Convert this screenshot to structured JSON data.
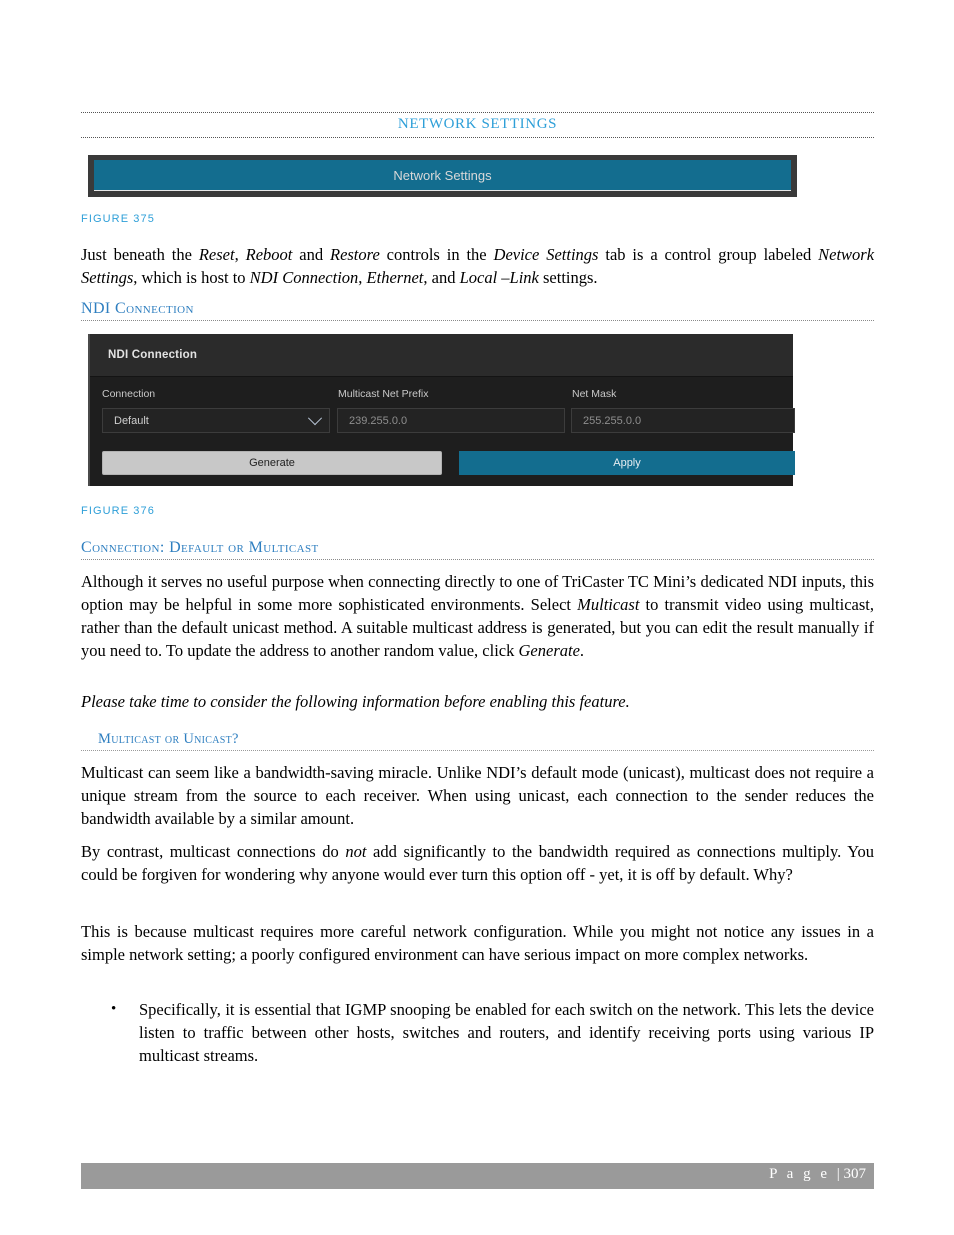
{
  "document": {
    "running_header": "Network Settings",
    "page_footer_prefix": "P a g e ",
    "page_footer_sep": "| ",
    "page_number": "307"
  },
  "figure_375": {
    "caption": "FIGURE 375",
    "bar_label": "Network Settings",
    "bar_color": "#136d8f",
    "frame_color": "#3a3a3a"
  },
  "intro_paragraph": {
    "segments": [
      {
        "text": "Just beneath the ",
        "style": "normal"
      },
      {
        "text": "Reset",
        "style": "italic"
      },
      {
        "text": ", ",
        "style": "normal"
      },
      {
        "text": "Reboot",
        "style": "italic"
      },
      {
        "text": " and ",
        "style": "normal"
      },
      {
        "text": "Restore",
        "style": "italic"
      },
      {
        "text": " controls in the ",
        "style": "normal"
      },
      {
        "text": "Device Settings",
        "style": "italic"
      },
      {
        "text": " tab is a control group labeled ",
        "style": "normal"
      },
      {
        "text": "Network Settings",
        "style": "italic"
      },
      {
        "text": ", which is host to ",
        "style": "normal"
      },
      {
        "text": "NDI Connection",
        "style": "italic"
      },
      {
        "text": ", ",
        "style": "normal"
      },
      {
        "text": "Ethernet",
        "style": "italic"
      },
      {
        "text": ", and ",
        "style": "normal"
      },
      {
        "text": "Local –Link",
        "style": "italic"
      },
      {
        "text": " settings.",
        "style": "normal"
      }
    ],
    "plain": "Just beneath the Reset, Reboot and Restore controls in the Device Settings tab is a control group labeled Network Settings, which is host to NDI Connection, Ethernet, and Local –Link settings."
  },
  "headings": {
    "ndi_connection": "NDI Connection",
    "connection_default_or_multicast": "Connection: Default or Multicast",
    "multicast_or_unicast": "Multicast or Unicast?"
  },
  "figure_376": {
    "caption": "FIGURE 376",
    "panel_title": "NDI Connection",
    "fields": [
      {
        "label": "Connection",
        "value": "Default",
        "type": "select",
        "icon": "chevron-down-icon"
      },
      {
        "label": "Multicast Net Prefix",
        "value": "239.255.0.0",
        "type": "text"
      },
      {
        "label": "Net Mask",
        "value": "255.255.0.0",
        "type": "text"
      }
    ],
    "buttons": [
      {
        "label": "Generate",
        "style": "light"
      },
      {
        "label": "Apply",
        "style": "accent"
      }
    ],
    "accent_color": "#136d8f",
    "panel_bg": "#1e1e1e",
    "titlebar_bg": "#2b2b2b"
  },
  "paragraphs": {
    "multicast_intro_pre": "Although it serves no useful purpose when connecting directly to one of TriCaster TC Mini’s dedicated NDI inputs, this option may be helpful in some more sophisticated environments.  Select ",
    "multicast_intro_em1": "Multicast",
    "multicast_intro_mid": " to transmit video using multicast, rather than the default unicast method. A suitable multicast address is generated, but you can edit the result manually if you need to.  To update the address to another random value, click ",
    "multicast_intro_em2": "Generate",
    "multicast_intro_end": ".",
    "please_note_italic": "Please take time to consider the following information before enabling this feature.",
    "unicast_para": "Multicast can seem like a bandwidth-saving miracle. Unlike NDI’s default mode (unicast), multicast does not require a unique stream from the source to each receiver. When using unicast, each connection to the sender reduces the bandwidth available by a similar amount.",
    "bycontrast_pre": "By contrast, multicast connections do ",
    "bycontrast_em": "not",
    "bycontrast_post": " add significantly to the bandwidth required as connections multiply. You could be forgiven for wondering why anyone would ever turn this option off - yet, it is off by default. Why?",
    "config_para": "This is because multicast requires more careful network configuration. While you might not notice any issues in a simple network setting; a poorly configured environment can have serious impact on more complex networks."
  },
  "bullets": [
    {
      "glyph": "•",
      "text": "Specifically, it is essential that IGMP snooping be enabled for each switch on the network. This lets the device listen to traffic between other hosts, switches and routers, and identify receiving ports using various IP multicast streams."
    }
  ]
}
